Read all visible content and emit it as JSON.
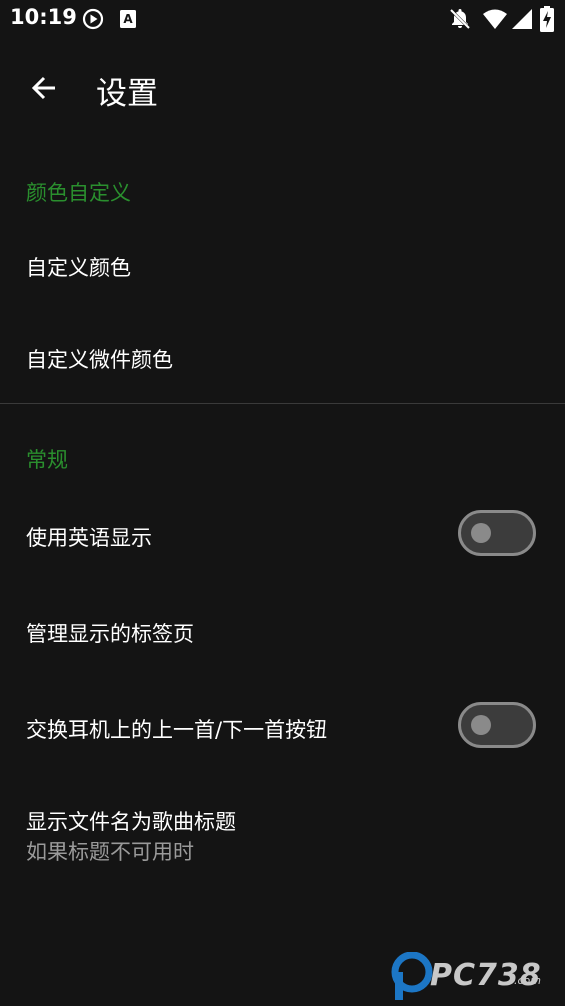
{
  "status_bar": {
    "time": "10:19",
    "icons": [
      "play-circle-icon",
      "a-notification-icon",
      "bell-off-icon",
      "wifi-icon",
      "signal-icon",
      "battery-charging-icon"
    ]
  },
  "toolbar": {
    "title": "设置",
    "back_icon": "arrow-back-icon"
  },
  "sections": {
    "color": {
      "header": "颜色自定义",
      "items": [
        {
          "title": "自定义颜色"
        },
        {
          "title": "自定义微件颜色"
        }
      ]
    },
    "general": {
      "header": "常规",
      "items": [
        {
          "title": "使用英语显示",
          "switch": false
        },
        {
          "title": "管理显示的标签页"
        },
        {
          "title": "交换耳机上的上一首/下一首按钮",
          "switch": false
        },
        {
          "title": "显示文件名为歌曲标题",
          "summary": "如果标题不可用时"
        }
      ]
    }
  },
  "watermark": {
    "text": "PC738",
    "sub": ".com"
  },
  "colors": {
    "background": "#141414",
    "accent": "#2a8f2e",
    "text_primary": "#ffffff",
    "text_secondary": "#9a9a9a",
    "switch_off": "#8a8a8a"
  }
}
